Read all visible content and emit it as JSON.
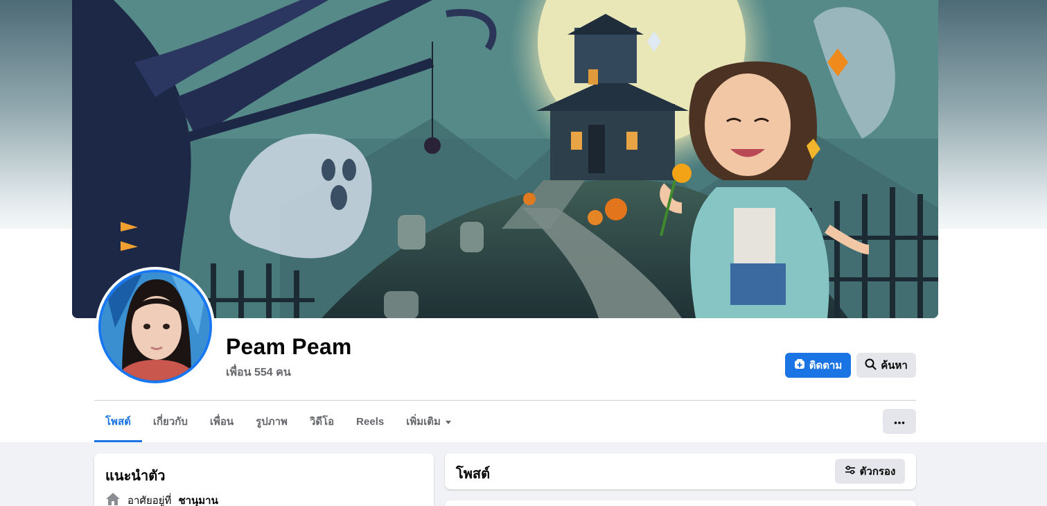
{
  "profile": {
    "name": "Peam Peam",
    "friends_text": "เพื่อน 554 คน"
  },
  "actions": {
    "follow_label": "ติดตาม",
    "search_label": "ค้นหา"
  },
  "tabs": [
    {
      "label": "โพสต์",
      "active": true
    },
    {
      "label": "เกี่ยวกับ",
      "active": false
    },
    {
      "label": "เพื่อน",
      "active": false
    },
    {
      "label": "รูปภาพ",
      "active": false
    },
    {
      "label": "วิดีโอ",
      "active": false
    },
    {
      "label": "Reels",
      "active": false
    },
    {
      "label": "เพิ่มเติม",
      "active": false
    }
  ],
  "intro": {
    "title": "แนะนำตัว",
    "lives_prefix": "อาศัยอยู่ที่",
    "lives_place": "ชานุมาน"
  },
  "posts": {
    "title": "โพสต์",
    "filter_label": "ตัวกรอง"
  },
  "colors": {
    "accent": "#1b74e4",
    "secondary_button": "#e4e6eb",
    "page_background": "#f0f2f5"
  },
  "icons": {
    "follow": "follow-icon",
    "search": "search-icon",
    "more_tab": "chevron-down-icon",
    "more_actions": "ellipsis-icon",
    "home": "home-icon",
    "filter": "filter-icon"
  }
}
